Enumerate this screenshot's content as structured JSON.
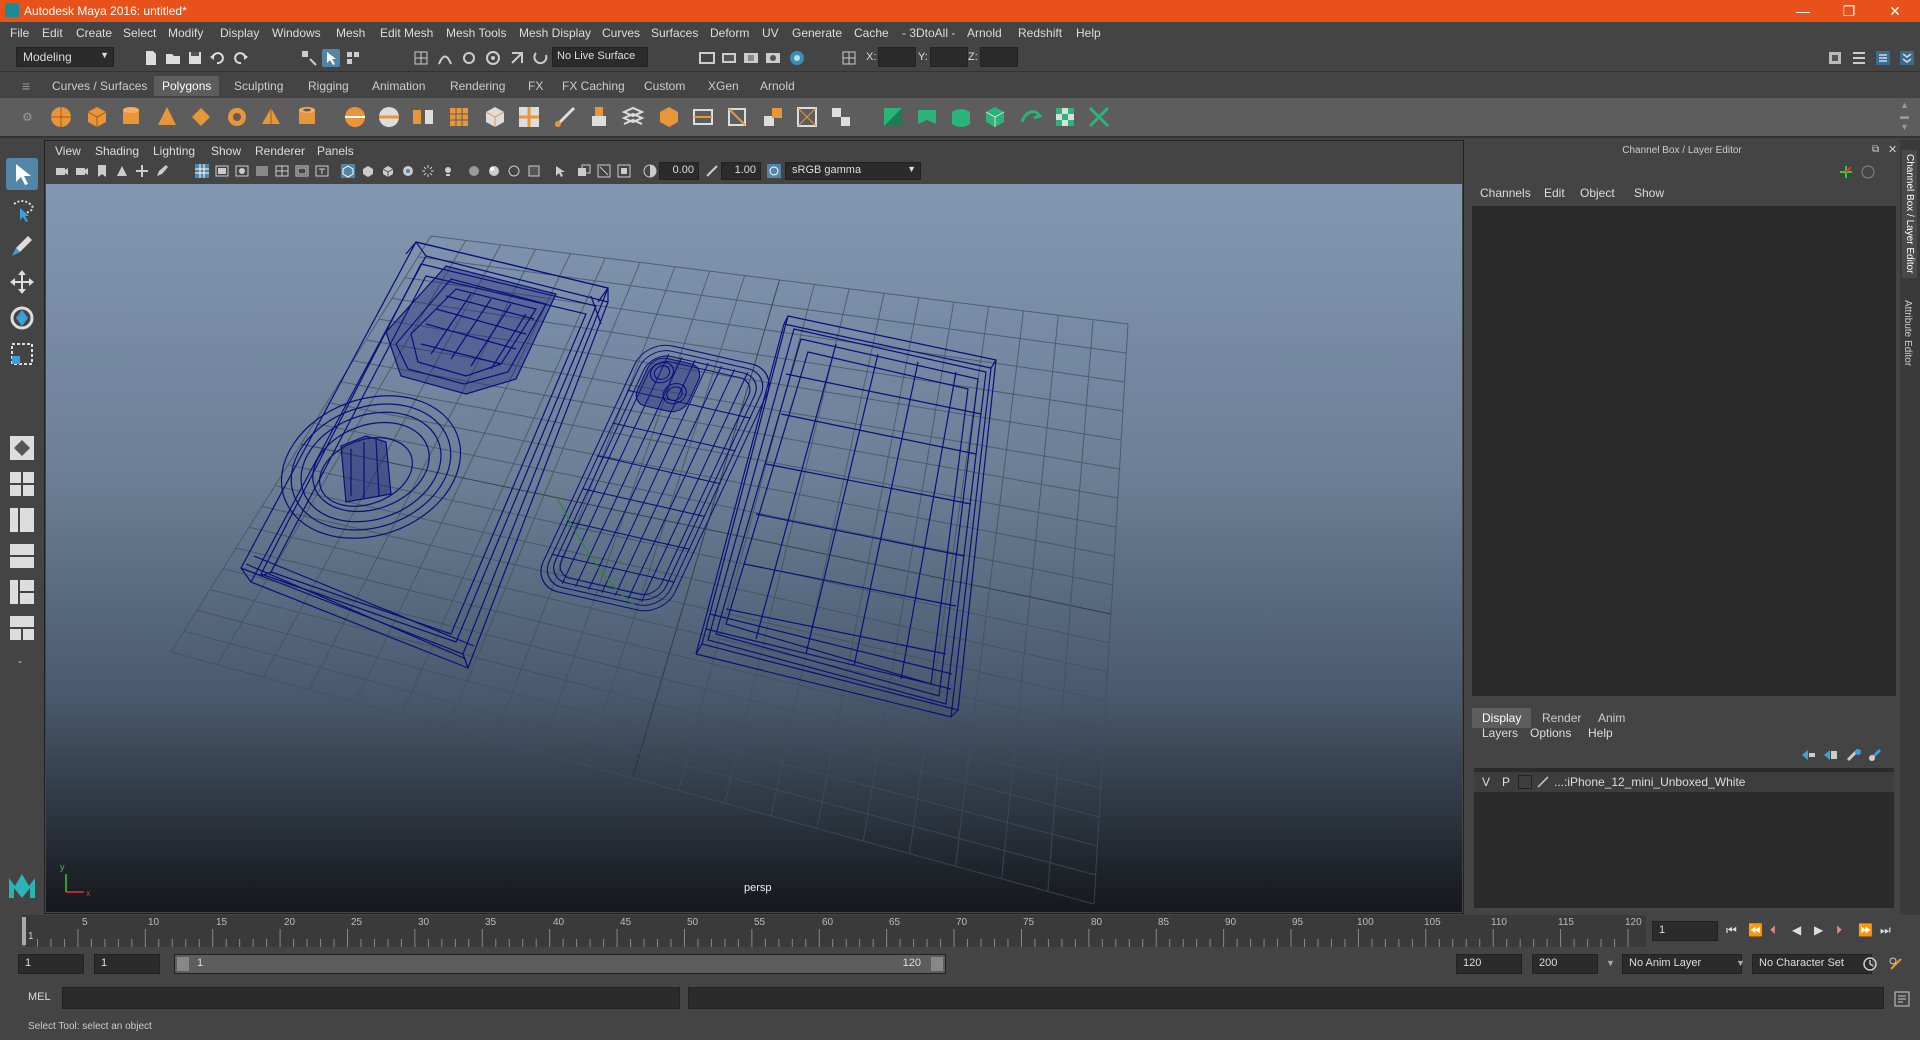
{
  "window": {
    "title": "Autodesk Maya 2016: untitled*",
    "controls": [
      "—",
      "❐",
      "✕"
    ]
  },
  "menubar": [
    "File",
    "Edit",
    "Create",
    "Select",
    "Modify",
    "Display",
    "Windows",
    "Mesh",
    "Edit Mesh",
    "Mesh Tools",
    "Mesh Display",
    "Curves",
    "Surfaces",
    "Deform",
    "UV",
    "Generate",
    "Cache",
    "- 3DtoAll -",
    "Arnold",
    "Redshift",
    "Help"
  ],
  "statusline": {
    "mode_menu": "Modeling",
    "live_surface": "No Live Surface",
    "x_label": "X:",
    "y_label": "Y:",
    "z_label": "Z:"
  },
  "shelf_tabs": [
    "Curves / Surfaces",
    "Polygons",
    "Sculpting",
    "Rigging",
    "Animation",
    "Rendering",
    "FX",
    "FX Caching",
    "Custom",
    "XGen",
    "Arnold"
  ],
  "shelf_active": "Polygons",
  "viewport": {
    "menu": [
      "View",
      "Shading",
      "Lighting",
      "Show",
      "Renderer",
      "Panels"
    ],
    "exposure": "0.00",
    "gamma": "1.00",
    "color_space": "sRGB gamma",
    "camera_label": "persp"
  },
  "channel_box": {
    "header": "Channel Box / Layer Editor",
    "menu": [
      "Channels",
      "Edit",
      "Object",
      "Show"
    ]
  },
  "side_tabs": [
    "Channel Box / Layer Editor",
    "Attribute Editor"
  ],
  "layer_editor": {
    "tabs": [
      "Display",
      "Render",
      "Anim"
    ],
    "active_tab": "Display",
    "menu": [
      "Layers",
      "Options",
      "Help"
    ],
    "layers": [
      {
        "v": "V",
        "p": "P",
        "name": "...:iPhone_12_mini_Unboxed_White"
      }
    ]
  },
  "timeline": {
    "ticks": [
      "5",
      "10",
      "15",
      "20",
      "25",
      "30",
      "35",
      "40",
      "45",
      "50",
      "55",
      "60",
      "65",
      "70",
      "75",
      "80",
      "85",
      "90",
      "95",
      "100",
      "105",
      "110",
      "115",
      "120"
    ],
    "first_tick": "1",
    "current_frame": "1"
  },
  "range": {
    "start": "1",
    "anim_start": "1",
    "slider_start": "1",
    "slider_end": "120",
    "anim_end": "120",
    "end": "200",
    "anim_layer": "No Anim Layer",
    "character_set": "No Character Set"
  },
  "cmdline": {
    "label": "MEL"
  },
  "helpline": {
    "text": "Select Tool: select an object"
  }
}
